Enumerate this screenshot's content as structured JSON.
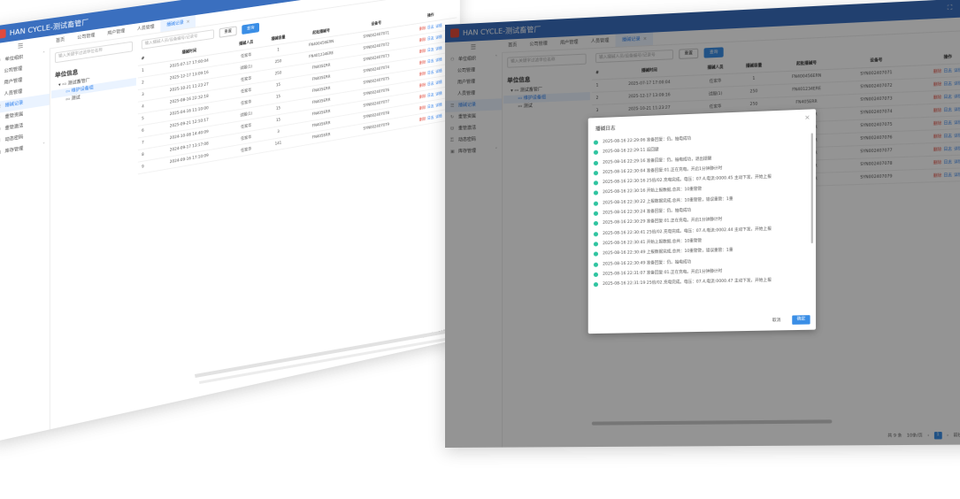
{
  "app": {
    "title": "HAN CYCLE-测试畜管厂",
    "accent": "#3a6fbf"
  },
  "sidebar": {
    "collapse_label": "☰",
    "items": [
      {
        "label": "单位组织",
        "icon": "org-icon"
      },
      {
        "label": "公司管理",
        "icon": ""
      },
      {
        "label": "用户管理",
        "icon": ""
      },
      {
        "label": "人员管理",
        "icon": ""
      },
      {
        "label": "播碱记录",
        "icon": "list-icon"
      },
      {
        "label": "重管资属",
        "icon": "refresh-icon"
      },
      {
        "label": "重管激活",
        "icon": "database-icon"
      },
      {
        "label": "动态密码",
        "icon": "key-icon"
      },
      {
        "label": "库存管理",
        "icon": "box-icon"
      }
    ]
  },
  "tabs": [
    "首页",
    "公司管理",
    "用户管理",
    "人员管理",
    "播碱记录"
  ],
  "tree": {
    "search_placeholder": "输入关键字过滤单位名称",
    "title": "单位信息",
    "root": "测试畜管厂",
    "child1": "维护设备组",
    "child2": "测试"
  },
  "filter": {
    "placeholder": "输入播碱人员/设备编号/记录号",
    "reset": "重置",
    "search": "查询"
  },
  "table": {
    "headers": [
      "#",
      "播碱时间",
      "播碱人员",
      "播碱容量",
      "起批播碱号",
      "设备号",
      "操作"
    ],
    "rows": [
      [
        "1",
        "2025-07-17 17:00:04",
        "任家华",
        "1",
        "FN400456ERN",
        "SYN002407071",
        "删除 日志 详情"
      ],
      [
        "2",
        "2025-12-17 13:09:16",
        "试服(1)",
        "250",
        "FN401234ERE",
        "SYN002407072",
        "删除 日志 详情"
      ],
      [
        "3",
        "2025-10-21 11:23:27",
        "任家华",
        "250",
        "FN405ERR",
        "SYN002407073",
        "删除 日志 详情"
      ],
      [
        "4",
        "2025-08-16 22:32:18",
        "任家华",
        "15",
        "FN405ERR",
        "SYN002407074",
        "删除 日志 详情"
      ],
      [
        "5",
        "2025-04-16 11:10:00",
        "任家华",
        "15",
        "FN405ERR",
        "SYN002407075",
        "删除 日志 详情"
      ],
      [
        "6",
        "2025-09-21 12:10:17",
        "试服(1)",
        "15",
        "FN405ERR",
        "SYN002407076",
        "删除 日志 详情"
      ],
      [
        "7",
        "2024-10-08 14:40:09",
        "任家华",
        "15",
        "FN405ERR",
        "SYN002407077",
        "删除 日志 详情"
      ],
      [
        "8",
        "2024-09-17 13:17:08",
        "任家华",
        "3",
        "FN405ERR",
        "SYN002407078",
        "删除 日志 详情"
      ],
      [
        "9",
        "2024-09-16 17:10:09",
        "任家华",
        "141",
        "FN405ERR",
        "SYN002407079",
        "删除 日志 详情"
      ]
    ]
  },
  "pager": {
    "total": "共 9 条",
    "size": "10条/页",
    "page": "1",
    "goto": "前往",
    "page_unit": "页"
  },
  "log_modal": {
    "title": "播碱日志",
    "entries": [
      "2025-08-16 22:29:06 准备回复：仍。抽电成功",
      "2025-08-16 22:29:11 返回键",
      "2025-08-16 22:29:16 准备回复：仍。抽电成功，退出提醒",
      "2025-08-16 22:30:04 准备回复:01.正在充电。开启1分钟静计时",
      "2025-08-16 22:30:16 25倍/02.充电完成。电压：07.4,电流:0000.45 主动下发，开始上报",
      "2025-08-16 22:30:16 开始上报数据,总共：10重管管",
      "2025-08-16 22:30:22 上报数据完成,总共：10重管管，错误重管：1重",
      "2025-08-16 22:30:24 准备回复：仍。抽电成功",
      "2025-08-16 22:30:29 准备回复:01.正在充电。开启1分钟静计时",
      "2025-08-16 22:30:41 25倍/02.充电完成。电压：07.4,电流:0002.44 主动下发，开始上报",
      "2025-08-16 22:30:41 开始上报数据,总共：10重管管",
      "2025-08-16 22:30:49 上报数据完成,总共：10重管管，错误重管：1重",
      "2025-08-16 22:30:49 准备回复：仍。抽电成功",
      "2025-08-16 22:31:07 准备回复:01.正在充电。开启1分钟静计时",
      "2025-08-16 22:31:19 25倍/02.充电完成。电压：07.4,电流:0000.47 主动下发，开始上报"
    ],
    "cancel": "取消",
    "confirm": "确定",
    "dot_color": "#2ec4a0"
  }
}
